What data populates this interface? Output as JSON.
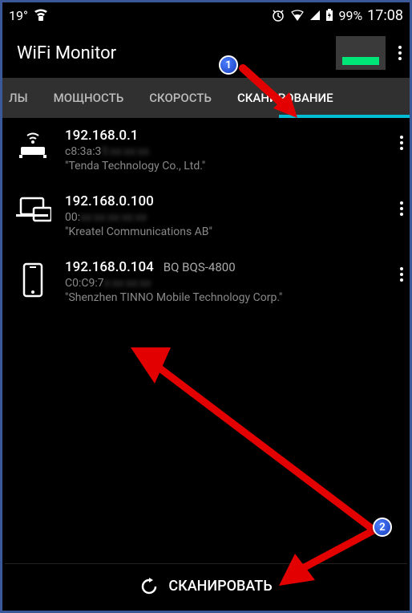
{
  "status_bar": {
    "temperature": "19°",
    "battery_pct": "99%",
    "time": "17:08"
  },
  "header": {
    "title": "WiFi Monitor"
  },
  "tabs": {
    "items": [
      {
        "label": "ЛЫ"
      },
      {
        "label": "МОЩНОСТЬ"
      },
      {
        "label": "СКОРОСТЬ"
      },
      {
        "label": "СКАНИРОВАНИЕ"
      }
    ],
    "active_index": 3
  },
  "devices": [
    {
      "ip": "192.168.0.1",
      "mac_visible": "c8:3a:3",
      "mac_hidden": "5:xx:xx:xx",
      "vendor": "\"Tenda Technology Co., Ltd.\"",
      "name": "",
      "icon": "router"
    },
    {
      "ip": "192.168.0.100",
      "mac_visible": "00:",
      "mac_hidden": "xx:xx:xx:xx:xx",
      "vendor": "\"Kreatel Communications AB\"",
      "name": "",
      "icon": "laptop"
    },
    {
      "ip": "192.168.0.104",
      "mac_visible": "C0:C9:7",
      "mac_hidden": "x:xx:xx:xx",
      "vendor": "\"Shenzhen TINNO Mobile Technology Corp.\"",
      "name": "BQ BQS-4800",
      "icon": "phone"
    }
  ],
  "bottom_button": {
    "label": "СКАНИРОВАТЬ"
  },
  "annotations": {
    "marker1": "1",
    "marker2": "2"
  }
}
